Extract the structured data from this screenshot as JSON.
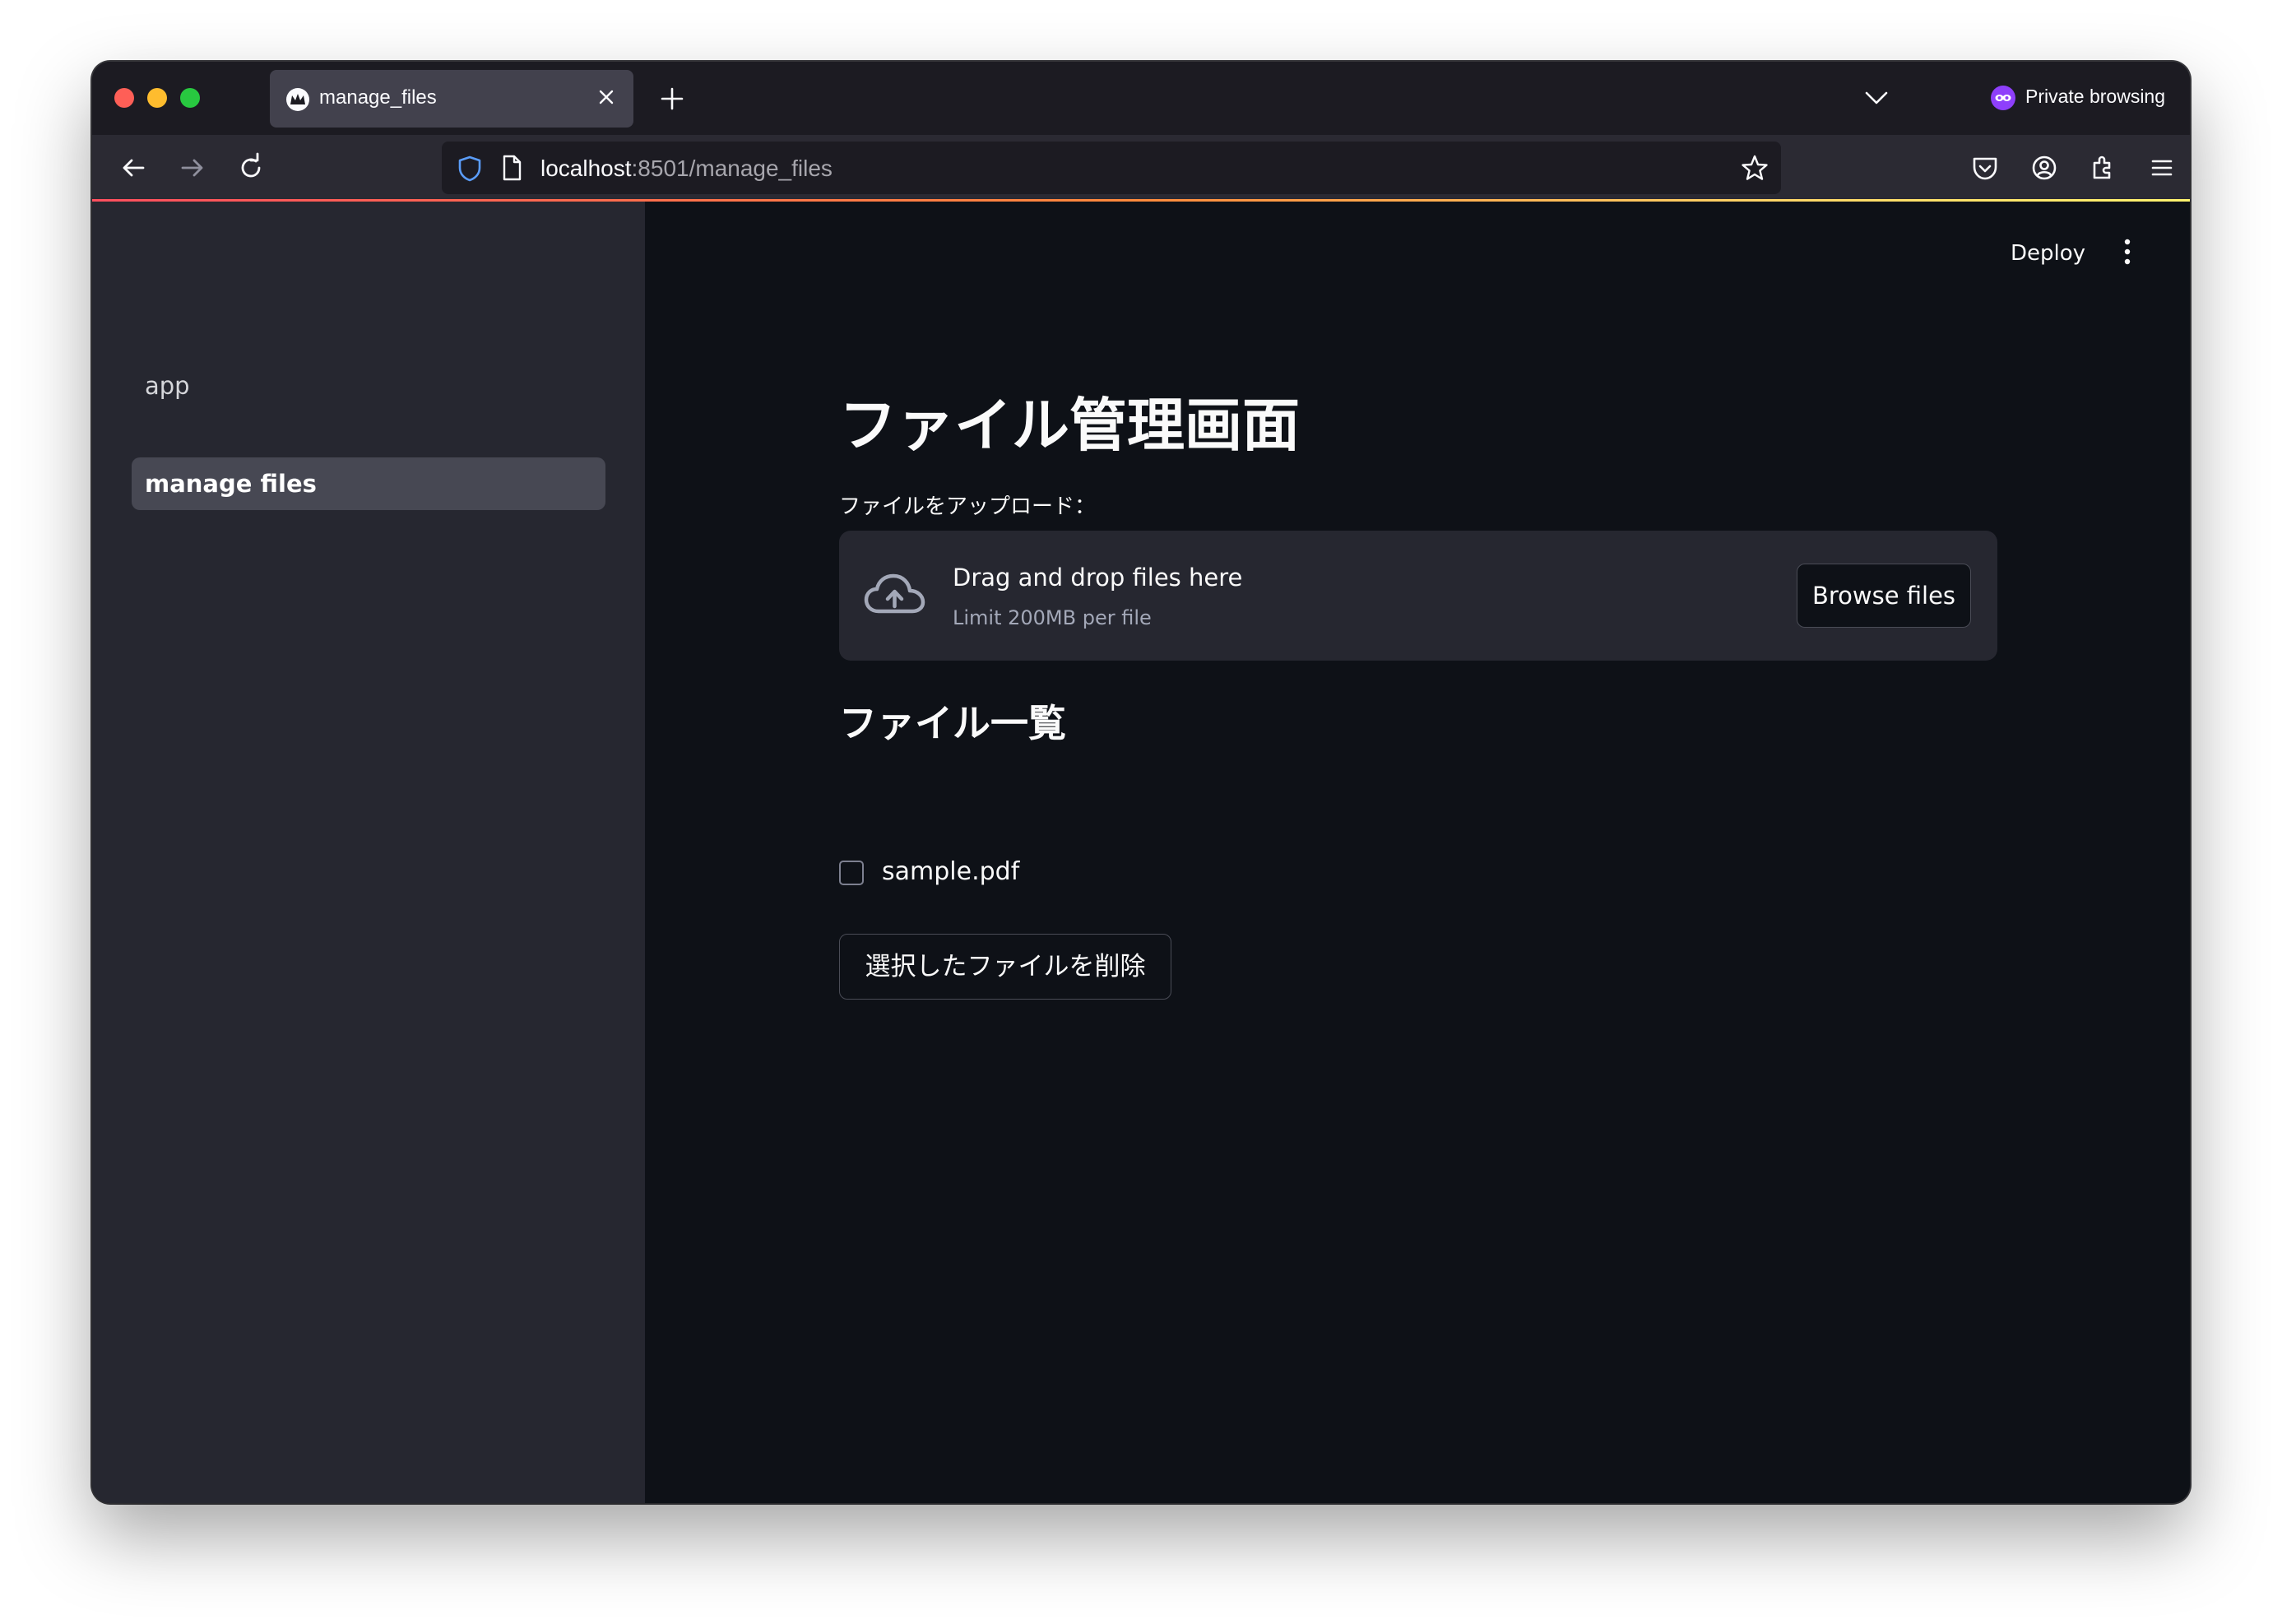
{
  "browser": {
    "tab_title": "manage_files",
    "private_label": "Private browsing",
    "url_host": "localhost",
    "url_rest": ":8501/manage_files"
  },
  "sidebar": {
    "items": [
      {
        "label": "app",
        "active": false
      },
      {
        "label": "manage files",
        "active": true
      }
    ]
  },
  "header": {
    "deploy_label": "Deploy"
  },
  "main": {
    "title": "ファイル管理画面",
    "upload_label": "ファイルをアップロード：",
    "dropzone": {
      "title": "Drag and drop files here",
      "subtitle": "Limit 200MB per file",
      "browse_label": "Browse files"
    },
    "list_heading": "ファイル一覧",
    "files": [
      {
        "name": "sample.pdf",
        "checked": false
      }
    ],
    "delete_label": "選択したファイルを削除"
  },
  "colors": {
    "accent_private": "#8e3ffb",
    "page_bg": "#0e1117",
    "sidebar_bg": "#262730"
  }
}
